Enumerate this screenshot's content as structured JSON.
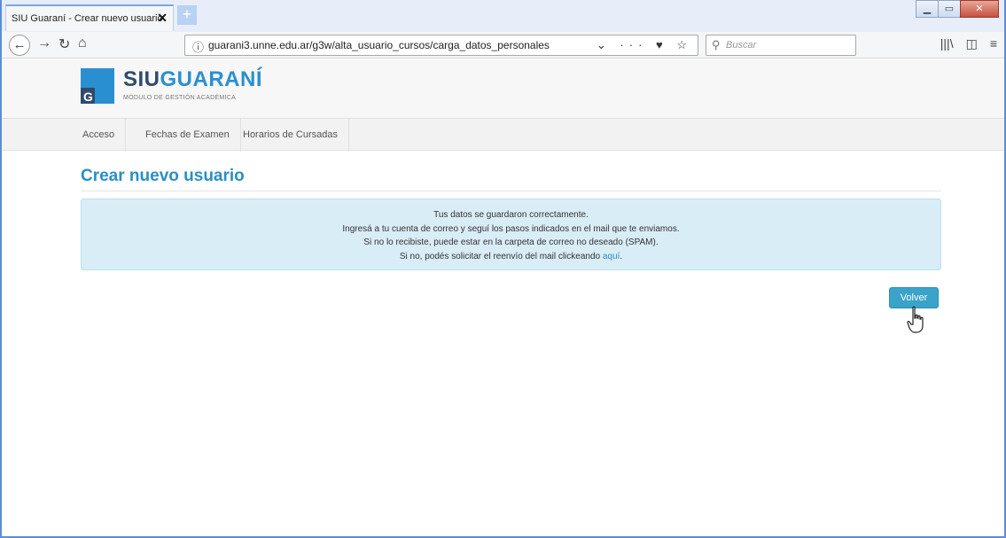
{
  "browser": {
    "tab_title": "SIU Guaraní - Crear nuevo usuario",
    "tab_close": "✕",
    "new_tab": "+",
    "url": "guarani3.unne.edu.ar/g3w/alta_usuario_cursos/carga_datos_personales",
    "search_placeholder": "Buscar",
    "url_actions": "⌄ ··· ♥ ☆",
    "right_tools": [
      "library-icon",
      "sidebar-icon",
      "menu-icon"
    ],
    "window_controls": [
      "minimize",
      "maximize",
      "close"
    ]
  },
  "site": {
    "logo_siu": "SIU",
    "logo_guarani": "GUARANÍ",
    "logo_subtitle": "MÓDULO DE GESTIÓN ACADÉMICA"
  },
  "menu": {
    "items": [
      {
        "label": "Acceso"
      },
      {
        "label": "Fechas de Examen"
      },
      {
        "label": "Horarios de Cursadas"
      }
    ]
  },
  "main": {
    "title": "Crear nuevo usuario",
    "alert_lines": [
      "Tus datos se guardaron correctamente.",
      "Ingresá a tu cuenta de correo y seguí los pasos indicados en el mail que te enviamos.",
      "Si no lo recibiste, puede estar en la carpeta de correo no deseado (SPAM).",
      "Si no, podés solicitar el reenvío del mail clickeando"
    ],
    "alert_link": "aquí",
    "alert_link_suffix": ".",
    "volver_label": "Volver"
  },
  "colors": {
    "accent": "#2a8fc4",
    "alert_bg": "#d9edf7",
    "button_bg": "#3aa3c9",
    "logo_dark": "#2f4a6d"
  }
}
